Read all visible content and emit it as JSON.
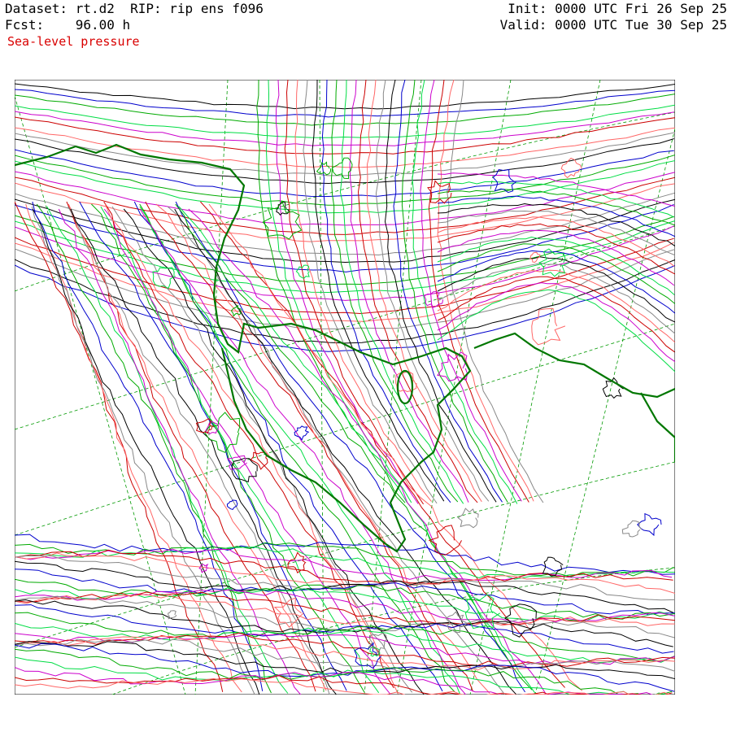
{
  "header": {
    "dataset": "Dataset: rt.d2  RIP: rip ens f096",
    "forecast": "Fcst:    96.00 h",
    "init": "Init: 0000 UTC Fri 26 Sep 25",
    "valid": "Valid: 0000 UTC Tue 30 Sep 25"
  },
  "field": {
    "label": "Sea-level pressure",
    "color": "#d90000"
  },
  "map": {
    "contour_colors": [
      "#000000",
      "#0000cc",
      "#00aa00",
      "#00dd44",
      "#cc00cc",
      "#cc0000",
      "#ff6666",
      "#888888"
    ],
    "coastline_color": "#007700",
    "grid_color": "#009900"
  }
}
